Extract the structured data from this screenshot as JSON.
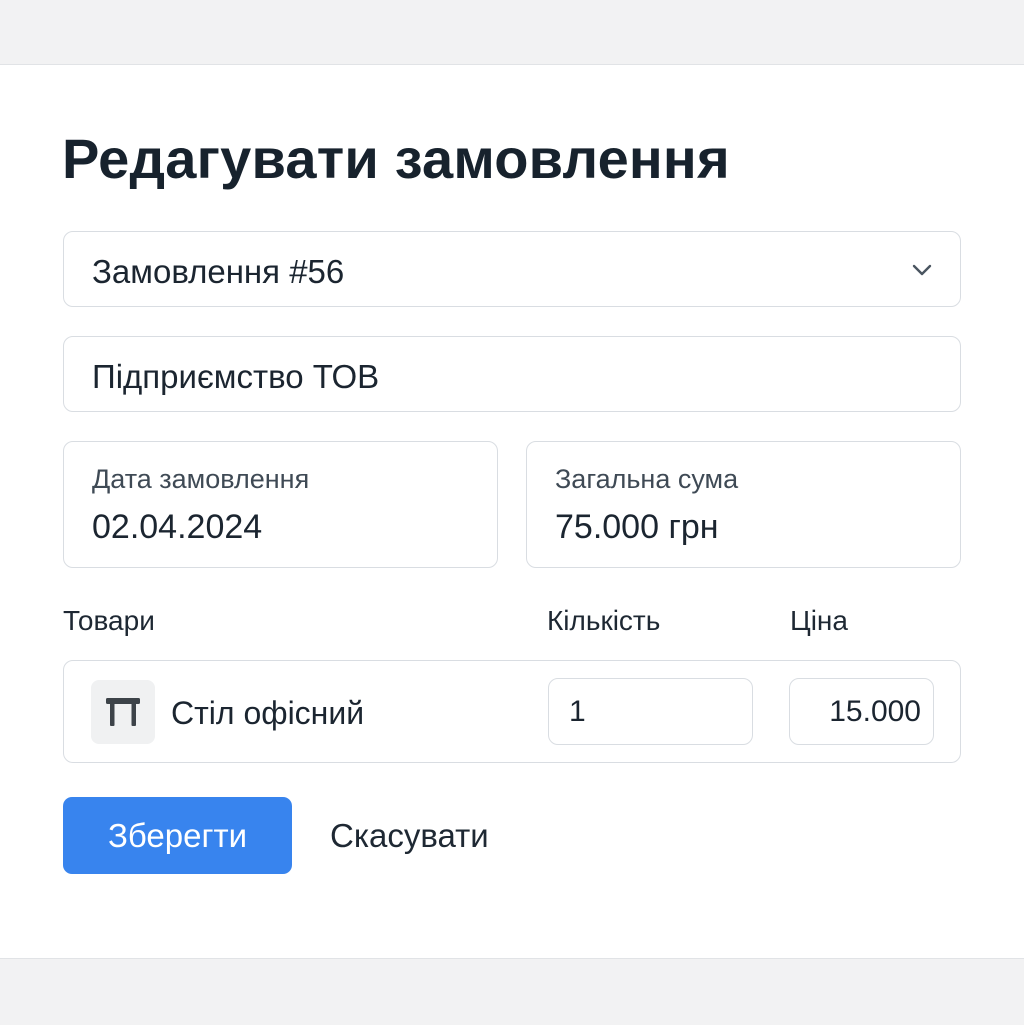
{
  "title": "Редагувати замовлення",
  "order_select": {
    "value": "Замовлення #56"
  },
  "company": {
    "value": "Підприємство ТОВ"
  },
  "order_date": {
    "label": "Дата замовлення",
    "value": "02.04.2024"
  },
  "total": {
    "label": "Загальна сума",
    "value": "75.000 грн"
  },
  "items_table": {
    "headers": [
      "Товари",
      "Кількість",
      "Ціна"
    ],
    "rows": [
      {
        "icon": "table-icon",
        "name": "Стіл офісний",
        "quantity": "1",
        "price": "15.000"
      }
    ]
  },
  "actions": {
    "save_label": "Зберегти",
    "cancel_label": "Скасувати"
  },
  "colors": {
    "primary": "#3884ee",
    "border": "#d9dde2",
    "text": "#1b2530"
  }
}
